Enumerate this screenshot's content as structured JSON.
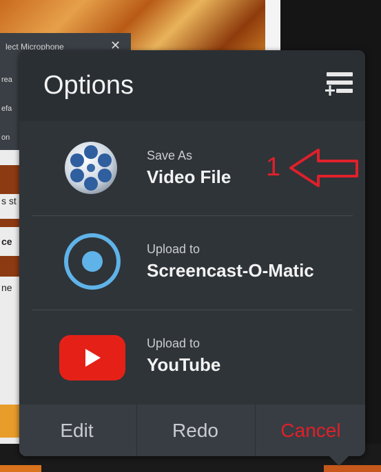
{
  "background": {
    "microphone_panel": {
      "title": "lect Microphone",
      "close_glyph": "✕"
    },
    "side_labels": [
      "rea",
      "efa",
      "on"
    ],
    "page_fragments": [
      "s st",
      "ce",
      "ne"
    ]
  },
  "dialog": {
    "title": "Options",
    "menu_icon": "menu-add-icon",
    "options": [
      {
        "small": "Save As",
        "big": "Video File",
        "icon": "film-reel-icon"
      },
      {
        "small": "Upload to",
        "big": "Screencast-O-Matic",
        "icon": "screencast-record-icon"
      },
      {
        "small": "Upload to",
        "big": "YouTube",
        "icon": "youtube-play-icon"
      }
    ],
    "footer": {
      "edit": "Edit",
      "redo": "Redo",
      "cancel": "Cancel"
    }
  },
  "annotation": {
    "number": "1",
    "color": "#e0202a"
  },
  "colors": {
    "dialog_bg": "#2f3439",
    "footer_bg": "#383d43",
    "cancel": "#e0202a",
    "screencast_blue": "#5fb3e8",
    "youtube_red": "#e52117"
  }
}
